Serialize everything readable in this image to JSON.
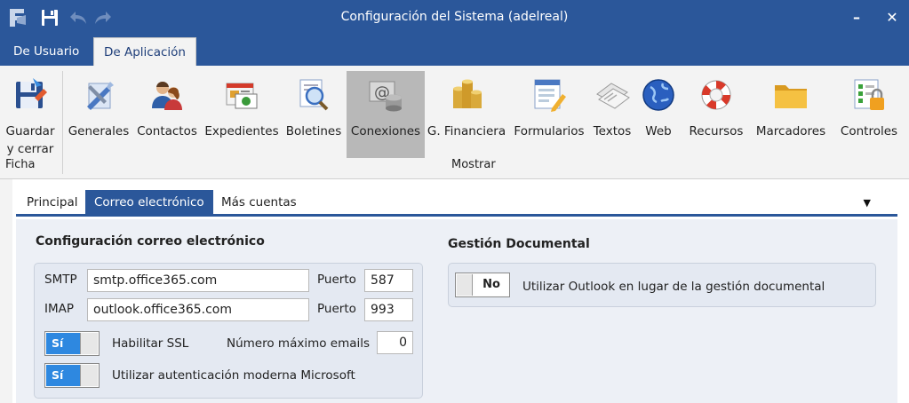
{
  "window": {
    "title": "Configuración del Sistema (adelreal)",
    "minimize": "–",
    "close": "✕"
  },
  "ribbon_tabs": [
    {
      "label": "De Usuario",
      "active": false
    },
    {
      "label": "De Aplicación",
      "active": true
    }
  ],
  "ribbon": {
    "ficha": {
      "group_label": "Ficha",
      "save_close": {
        "line1": "Guardar",
        "line2": "y cerrar"
      }
    },
    "mostrar": {
      "group_label": "Mostrar",
      "buttons": [
        {
          "label": "Generales",
          "icon": "tools-icon"
        },
        {
          "label": "Contactos",
          "icon": "people-icon"
        },
        {
          "label": "Expedientes",
          "icon": "folder-file-icon"
        },
        {
          "label": "Boletines",
          "icon": "magnifier-document-icon"
        },
        {
          "label": "Conexiones",
          "icon": "at-database-icon",
          "selected": true
        },
        {
          "label": "G. Financiera",
          "icon": "coins-icon"
        },
        {
          "label": "Formularios",
          "icon": "form-pencil-icon"
        },
        {
          "label": "Textos",
          "icon": "documents-icon"
        },
        {
          "label": "Web",
          "icon": "globe-icon"
        },
        {
          "label": "Recursos",
          "icon": "lifebuoy-icon"
        },
        {
          "label": "Marcadores",
          "icon": "folder-icon"
        },
        {
          "label": "Controles",
          "icon": "checklist-lock-icon"
        }
      ]
    }
  },
  "subtabs": [
    {
      "label": "Principal",
      "active": false
    },
    {
      "label": "Correo electrónico",
      "active": true
    },
    {
      "label": "Más cuentas",
      "active": false
    }
  ],
  "email_config": {
    "heading": "Configuración correo electrónico",
    "smtp_label": "SMTP",
    "smtp_value": "smtp.office365.com",
    "smtp_port_label": "Puerto",
    "smtp_port_value": "587",
    "imap_label": "IMAP",
    "imap_value": "outlook.office365.com",
    "imap_port_label": "Puerto",
    "imap_port_value": "993",
    "ssl_toggle": "Sí",
    "ssl_label": "Habilitar SSL",
    "max_emails_label": "Número máximo emails",
    "max_emails_value": "0",
    "modern_auth_toggle": "Sí",
    "modern_auth_label": "Utilizar autenticación moderna Microsoft"
  },
  "doc_management": {
    "heading": "Gestión Documental",
    "outlook_toggle": "No",
    "outlook_label": "Utilizar Outlook en lugar de la gestión documental"
  },
  "colors": {
    "titlebar": "#2b579a",
    "ribbon_bg": "#f3f3f3",
    "toggle_on": "#2e88e0",
    "panel_bg": "#edf0f6"
  }
}
